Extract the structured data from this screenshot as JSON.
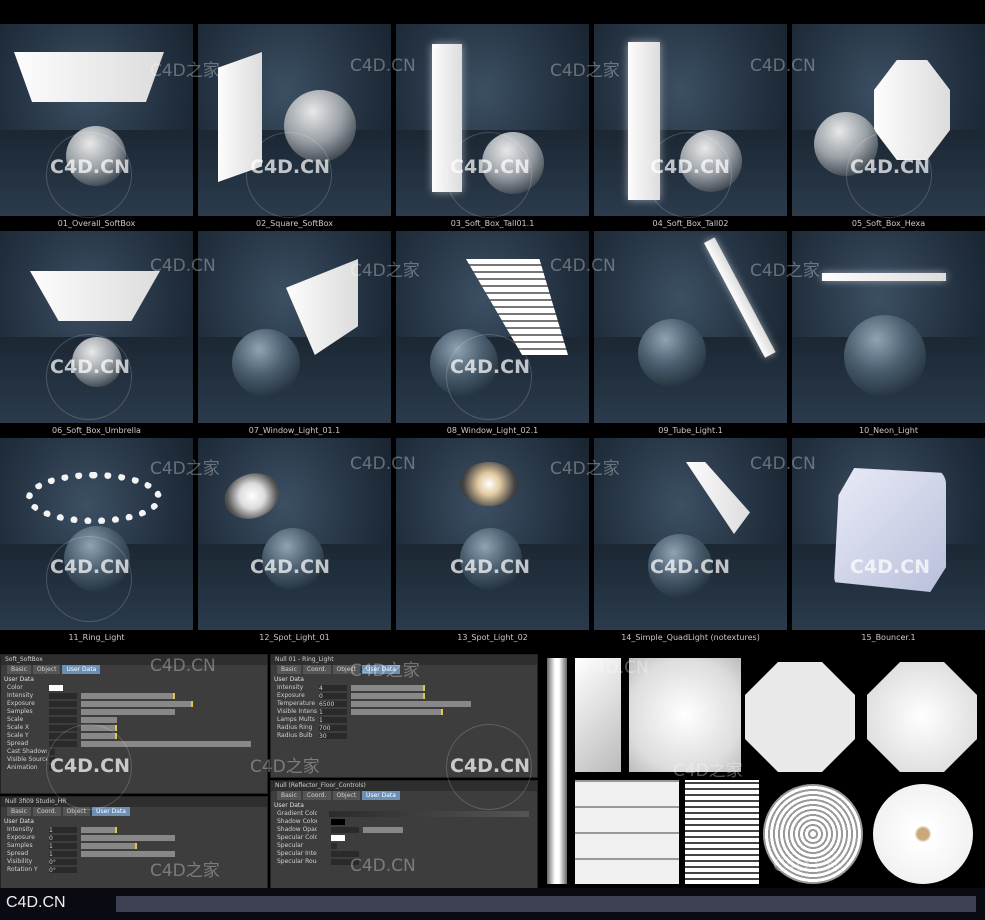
{
  "grid": {
    "captions": [
      "01_Overall_SoftBox",
      "02_Square_SoftBox",
      "03_Soft_Box_Tall01.1",
      "04_Soft_Box_Tall02",
      "05_Soft_Box_Hexa",
      "06_Soft_Box_Umbrella",
      "07_Window_Light_01.1",
      "08_Window_Light_02.1",
      "09_Tube_Light.1",
      "10_Neon_Light",
      "11_Ring_Light",
      "12_Spot_Light_01",
      "13_Spot_Light_02",
      "14_Simple_QuadLight (notextures)",
      "15_Bouncer.1"
    ]
  },
  "watermarks": {
    "text_cn": "C4D之家",
    "text_domain": "C4D.CN",
    "logo": "C4D.CN"
  },
  "panels": {
    "p1": {
      "title": "Soft_SoftBox",
      "tabs": [
        "Basic",
        "Object",
        "User Data"
      ],
      "section": "User Data",
      "rows": [
        "Color",
        "Intensity",
        "Exposure",
        "Samples",
        "Scale",
        "Scale X",
        "Scale Y",
        "Spread",
        "Cast Shadows",
        "Visible Source",
        "Animation"
      ]
    },
    "p2": {
      "title": "Null 01 - Ring_Light",
      "tabs": [
        "Basic",
        "Coord.",
        "Object",
        "User Data"
      ],
      "section": "User Data",
      "rows": [
        "Intensity",
        "Exposure",
        "Temperature",
        "Visible Intensity",
        "Lamps Mults",
        "Radius Ring",
        "Radius Bulb"
      ],
      "values": [
        "4",
        "0",
        "6500",
        "1",
        "1",
        "700",
        "30"
      ]
    },
    "p3": {
      "title": "Null 3fi09 Studio_HR",
      "tabs": [
        "Basic",
        "Coord.",
        "Object",
        "User Data"
      ],
      "section": "User Data",
      "rows": [
        "Intensity",
        "Exposure",
        "Samples",
        "Spread",
        "Visibility",
        "Rotation Y"
      ],
      "values": [
        "1",
        "0",
        "1",
        "1",
        "0°",
        "0°"
      ]
    },
    "p4": {
      "title": "Null (Reflector_Floor_Controls)",
      "tabs": [
        "Basic",
        "Coord.",
        "Object",
        "User Data"
      ],
      "section": "User Data",
      "rows": [
        "Gradient Color",
        "Shadow Color",
        "Shadow Opacity",
        "Specular Color",
        "Specular",
        "Specular Intensity",
        "Specular Roughness"
      ]
    }
  },
  "footer": {
    "brand": "C4D.CN"
  },
  "colors": {
    "accent_tab": "#6b8fb5",
    "slider_knob": "#e0c64a",
    "background": "#000000"
  }
}
